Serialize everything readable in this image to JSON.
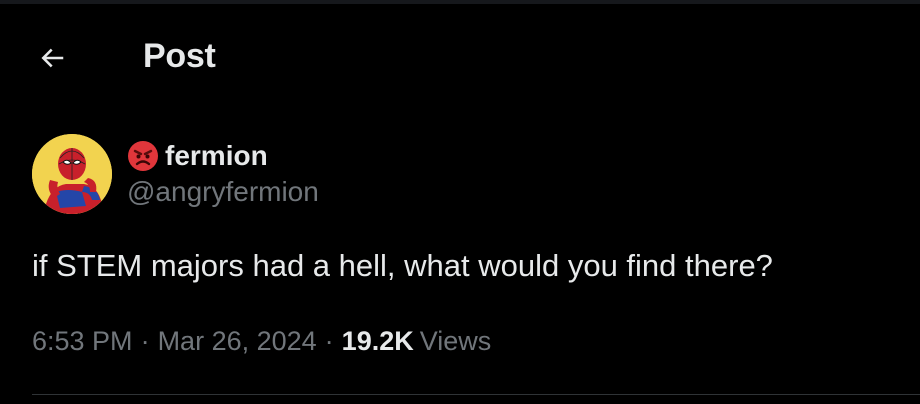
{
  "header": {
    "back_icon": "arrow-left-icon",
    "title": "Post"
  },
  "author": {
    "avatar_icon": "spiderman-avatar",
    "badge_icon": "angry-face-emoji-icon",
    "display_name": "fermion",
    "handle": "@angryfermion"
  },
  "post": {
    "text": "if STEM majors had a hell, what would you find there?"
  },
  "meta": {
    "time": "6:53 PM",
    "separator": "·",
    "date": "Mar 26, 2024",
    "views_count": "19.2K",
    "views_label": "Views"
  },
  "colors": {
    "background": "#000000",
    "primary_text": "#e7e9ea",
    "secondary_text": "#71767b",
    "divider": "#2f3336"
  }
}
